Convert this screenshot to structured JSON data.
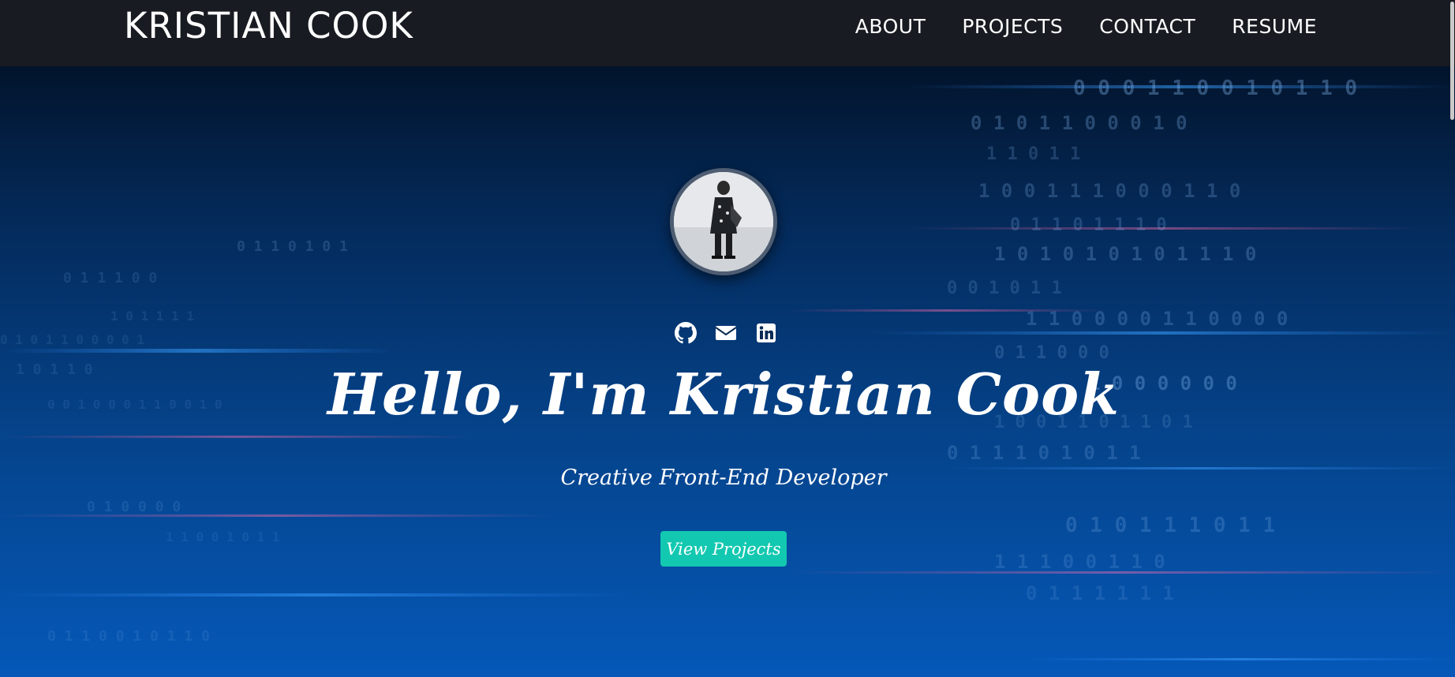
{
  "nav": {
    "brand": "KRISTIAN COOK",
    "links": [
      {
        "label": "ABOUT"
      },
      {
        "label": "PROJECTS"
      },
      {
        "label": "CONTACT"
      },
      {
        "label": "RESUME"
      }
    ]
  },
  "hero": {
    "title": "Hello, I'm Kristian Cook",
    "subtitle": "Creative Front-End Developer",
    "cta_label": "View Projects",
    "social_icons": [
      "github-icon",
      "envelope-icon",
      "linkedin-icon"
    ],
    "background_digits": [
      "0 0 0 1 1 0 0 1 0 1 1 0",
      "0 1 0 1 1 0 0 0 1 0",
      "1 1 0 1 1",
      "1 0 0 1 1 1 0 0 0 1 1 0",
      "0 1 1 0 1 1 1 0",
      "1 0 1 0 1 0 1 0 1 1 1 0",
      "0 0 1 0 1 1",
      "1 1 0 0 0 0 1 1 0 0 0 0",
      "0 1 1 0 0 0",
      "1 0 0 0 0 0 0",
      "1 0 0 1 1 0 1 1 0 1",
      "0 1 1 1 0 1 0 1 1",
      "0 1 0 1 1 1 0 1 1",
      "1 1 1 0 0 1 1 0",
      "0 1 1 1 1 1 1",
      "0 1 1 0 1 0 1",
      "0 1 1 1 0 0",
      "1 0 1 1 1 1",
      "0 1 0 1 1 0 0 0 0 1",
      "1 0 1 1 0",
      "0 0 1 0 0 0 1 1 0 0 1 0",
      "0 1 0 0 0 0",
      "1 1 0 0 1 0 1 1",
      "0 1 1 0 0 1 0 1 1 0"
    ]
  },
  "colors": {
    "navbar_bg": "#181b21",
    "hero_top": "#02142c",
    "hero_bottom": "#0558b8",
    "accent": "#13c8b0",
    "text": "#ffffff"
  }
}
